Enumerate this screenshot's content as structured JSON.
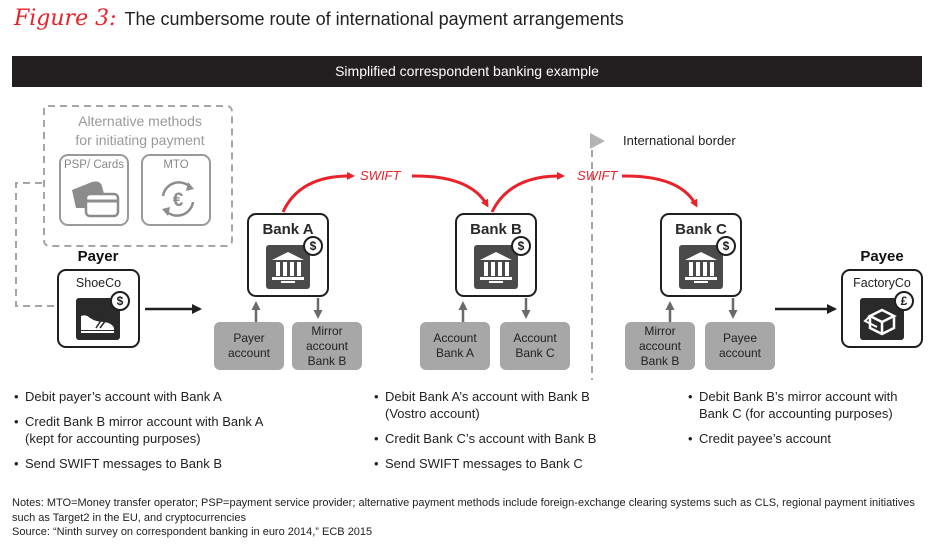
{
  "figure": {
    "label": "Figure 3:",
    "title": "The cumbersome route of international payment arrangements"
  },
  "banner": "Simplified correspondent banking example",
  "alternative_methods": {
    "title_line1": "Alternative methods",
    "title_line2": "for initiating payment",
    "items": [
      {
        "label": "PSP/ Cards",
        "icon": "card-payment-icon"
      },
      {
        "label": "MTO",
        "icon": "euro-exchange-icon"
      }
    ]
  },
  "payer": {
    "role": "Payer",
    "company": "ShoeCo",
    "icon": "shoe-icon",
    "currency_badge": "$"
  },
  "payee": {
    "role": "Payee",
    "company": "FactoryCo",
    "icon": "package-icon",
    "currency_badge": "£"
  },
  "banks": [
    {
      "name": "Bank A",
      "currency_badge": "$",
      "accounts": [
        {
          "line1": "Payer",
          "line2": "account",
          "line3": ""
        },
        {
          "line1": "Mirror",
          "line2": "account",
          "line3": "Bank B"
        }
      ],
      "bullets": [
        "Debit payer’s account with Bank A",
        "Credit Bank B mirror account with Bank A (kept for accounting purposes)",
        "Send SWIFT messages to Bank B"
      ]
    },
    {
      "name": "Bank B",
      "currency_badge": "$",
      "accounts": [
        {
          "line1": "Account",
          "line2": "Bank A",
          "line3": ""
        },
        {
          "line1": "Account",
          "line2": "Bank C",
          "line3": ""
        }
      ],
      "bullets": [
        "Debit Bank A’s account with Bank B (Vostro account)",
        "Credit Bank C’s account with Bank B",
        "Send SWIFT messages to Bank C"
      ]
    },
    {
      "name": "Bank C",
      "currency_badge": "$",
      "accounts": [
        {
          "line1": "Mirror",
          "line2": "account",
          "line3": "Bank B"
        },
        {
          "line1": "Payee",
          "line2": "account",
          "line3": ""
        }
      ],
      "bullets": [
        "Debit Bank B’s mirror account with Bank C (for accounting purposes)",
        "Credit payee’s account"
      ]
    }
  ],
  "swift_labels": [
    "SWIFT",
    "SWIFT"
  ],
  "international_border_label": "International border",
  "colors": {
    "accent_red": "#e8232b",
    "banner_bg": "#231f20",
    "account_gray": "#a7a7a7",
    "dashed_gray": "#9a9a9a"
  },
  "notes": {
    "line1": "Notes: MTO=Money transfer operator; PSP=payment service provider; alternative payment methods include foreign-exchange clearing systems such as CLS, regional payment initiatives such as Target2 in the EU, and cryptocurrencies",
    "source": "Source: “Ninth survey on correspondent banking in euro 2014,” ECB 2015"
  }
}
